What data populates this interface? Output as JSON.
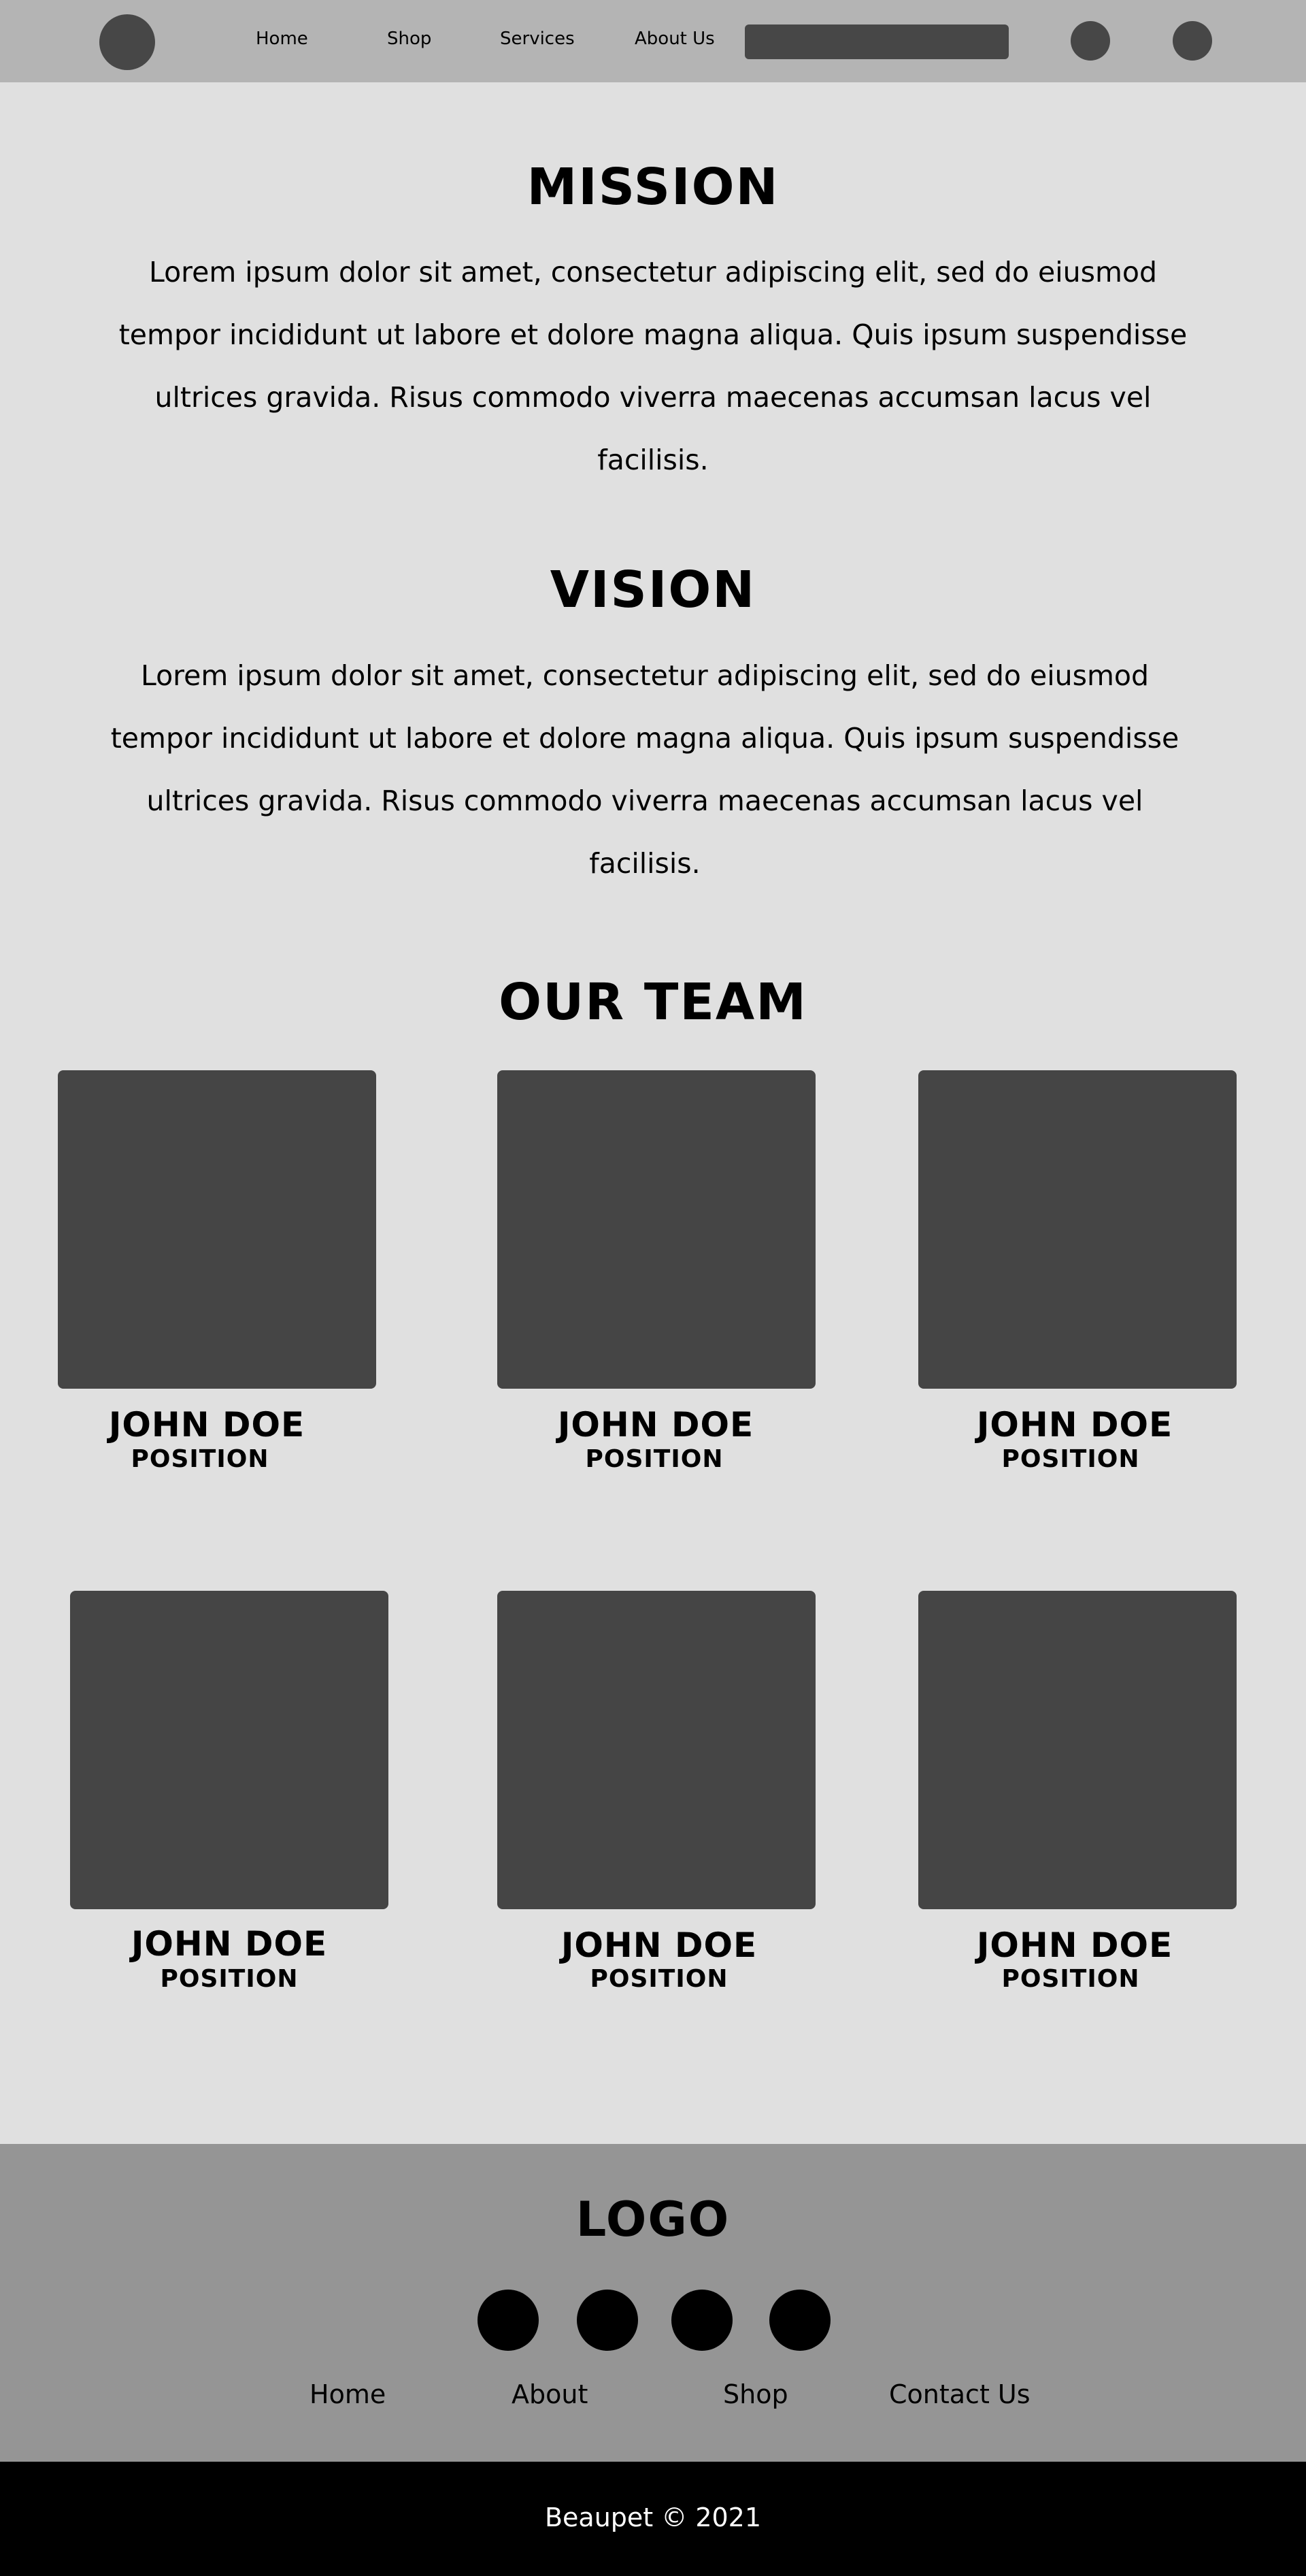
{
  "header": {
    "nav": [
      "Home",
      "Shop",
      "Services",
      "About Us"
    ],
    "search_placeholder": ""
  },
  "mission": {
    "title": "MISSION",
    "text": "Lorem ipsum dolor sit amet, consectetur adipiscing elit, sed do eiusmod tempor incididunt ut labore et dolore magna aliqua. Quis ipsum suspendisse ultrices gravida. Risus commodo viverra maecenas accumsan lacus vel facilisis."
  },
  "vision": {
    "title": "VISION",
    "text": "Lorem ipsum dolor sit amet, consectetur adipiscing elit, sed do eiusmod tempor incididunt ut labore et dolore magna aliqua. Quis ipsum suspendisse ultrices gravida. Risus commodo viverra maecenas accumsan lacus vel facilisis."
  },
  "team": {
    "title": "OUR TEAM",
    "members": [
      {
        "name": "JOHN DOE",
        "position": "POSITION"
      },
      {
        "name": "JOHN DOE",
        "position": "POSITION"
      },
      {
        "name": "JOHN DOE",
        "position": "POSITION"
      },
      {
        "name": "JOHN DOE",
        "position": "POSITION"
      },
      {
        "name": "JOHN DOE",
        "position": "POSITION"
      },
      {
        "name": "JOHN DOE",
        "position": "POSITION"
      }
    ]
  },
  "footer": {
    "logo": "LOGO",
    "links": [
      "Home",
      "About",
      "Shop",
      "Contact Us"
    ],
    "copyright": "Beaupet © 2021"
  },
  "colors": {
    "header_bg": "#b4b4b4",
    "page_bg": "#e0e0e0",
    "placeholder_dark": "#454545",
    "footer_bg": "#959595",
    "bottom_bar_bg": "#000000"
  }
}
